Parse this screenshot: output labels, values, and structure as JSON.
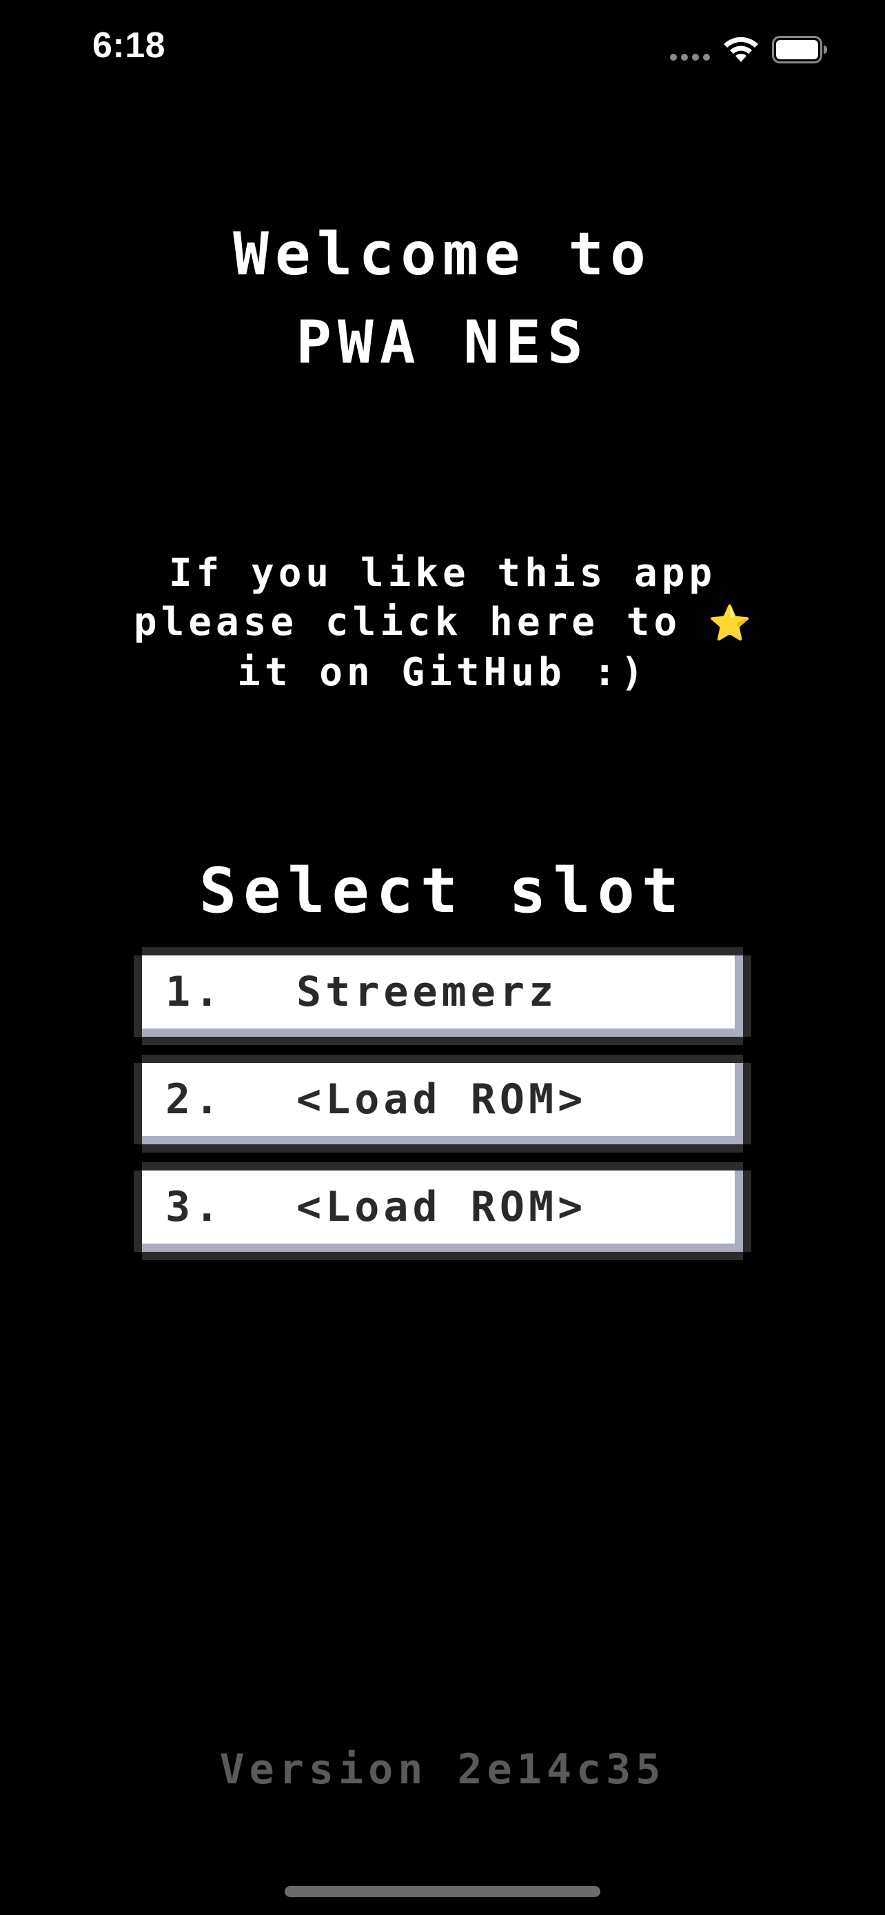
{
  "status_bar": {
    "time": "6:18",
    "signal_icon": "signal-dots-icon",
    "wifi_icon": "wifi-icon",
    "battery_icon": "battery-full-icon"
  },
  "welcome": {
    "line1": "Welcome to",
    "line2": "PWA NES"
  },
  "star_message": {
    "line1": "If you like this app",
    "line2_text": "please click here to",
    "line2_icon": "star-icon",
    "star_glyph": "⭐",
    "line3": "it on GitHub :)"
  },
  "select_slot": {
    "title": "Select slot",
    "slots": [
      {
        "number": "1.",
        "label": "Streemerz"
      },
      {
        "number": "2.",
        "label": "<Load ROM>"
      },
      {
        "number": "3.",
        "label": "<Load ROM>"
      }
    ]
  },
  "version": {
    "text": "Version 2e14c35"
  },
  "colors": {
    "background": "#000000",
    "text": "#ffffff",
    "slot_face": "#ffffff",
    "slot_shadow": "#a9adbf",
    "slot_frame": "#2b2b2b",
    "version_text": "#5a5a5a",
    "star": "#f3d33a"
  }
}
